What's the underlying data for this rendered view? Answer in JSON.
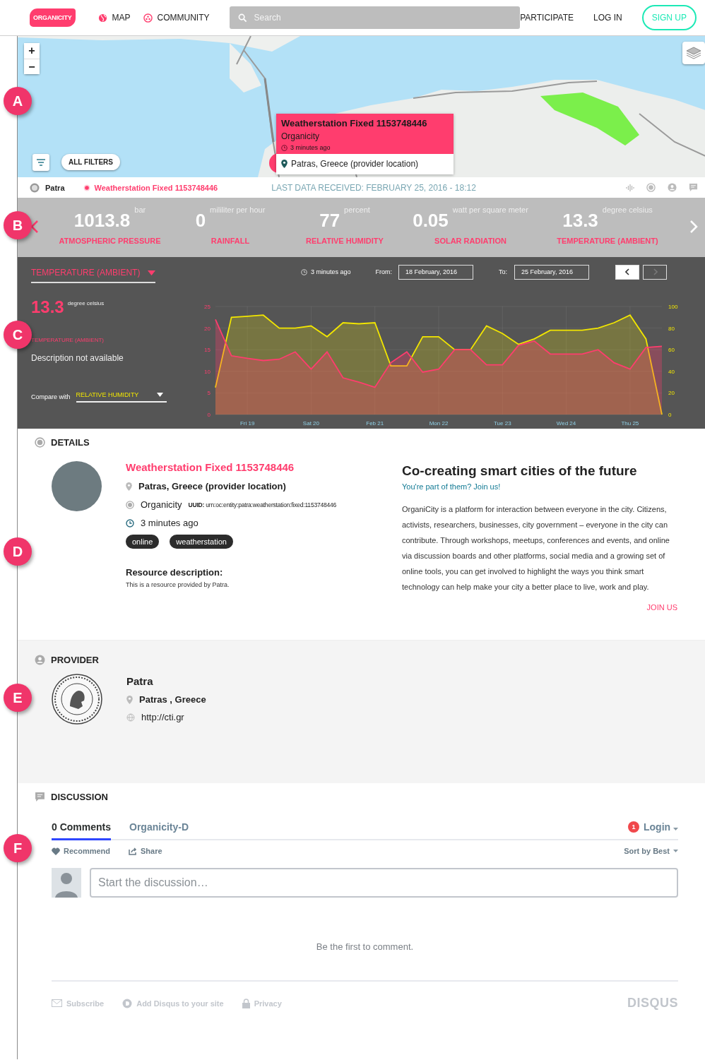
{
  "nav": {
    "logo": "ORGANICITY",
    "links": [
      {
        "label": "MAP",
        "kind": "globe"
      },
      {
        "label": "COMMUNITY",
        "kind": "community"
      }
    ],
    "search": {
      "placeholder": "Search"
    },
    "actions": [
      {
        "label": "PARTICIPATE",
        "kind": "link"
      },
      {
        "label": "LOG IN",
        "kind": "link"
      },
      {
        "label": "SIGN UP",
        "kind": "outline"
      }
    ]
  },
  "map": {
    "zoom_in": "+",
    "zoom_out": "−",
    "filters_button": "ALL FILTERS",
    "popup": {
      "title": "Weatherstation Fixed 1153748446",
      "provider": "Organicity",
      "time": "3 minutes ago",
      "location": "Patras, Greece (provider location)"
    }
  },
  "info_bar": {
    "provider": "Patra",
    "asset": "Weatherstation Fixed 1153748446",
    "last_data": "LAST DATA RECEIVED: FEBRUARY 25, 2016 - 18:12"
  },
  "metrics": [
    {
      "value": "1013.8",
      "unit": "bar",
      "label": "ATMOSPHERIC PRESSURE"
    },
    {
      "value": "0",
      "unit": "mililiter per hour",
      "label": "RAINFALL"
    },
    {
      "value": "77",
      "unit": "percent",
      "label": "RELATIVE HUMIDITY"
    },
    {
      "value": "0.05",
      "unit": "watt per square meter",
      "label": "SOLAR RADIATION"
    },
    {
      "value": "13.3",
      "unit": "degree celsius",
      "label": "TEMPERATURE (AMBIENT)"
    }
  ],
  "chart_panel": {
    "time": "3 minutes ago",
    "from_label": "From:",
    "from": "18 February, 2016",
    "to_label": "To:",
    "to": "25 February, 2016",
    "prev": {
      "disabled": false
    },
    "next": {
      "disabled": true
    },
    "current_value": "13.3",
    "current_unit": "degree celsius",
    "current_label": "TEMPERATURE (AMBIENT)",
    "description": "Description not available",
    "compare_label": "Compare with",
    "chart_data": {
      "type": "area",
      "grid": true,
      "ylim": [
        0,
        25
      ],
      "y2lim": [
        0,
        100
      ],
      "categories": [
        null,
        null,
        "Fri 19",
        null,
        null,
        null,
        "Sat 20",
        null,
        null,
        null,
        "Feb 21",
        null,
        null,
        null,
        "Mon 22",
        null,
        null,
        null,
        "Tue 23",
        null,
        null,
        null,
        "Wed 24",
        null,
        null,
        null,
        "Thu 25",
        null,
        null
      ],
      "yticks": [
        0,
        5,
        10,
        15,
        20,
        25
      ],
      "y2ticks": [
        0,
        20,
        40,
        60,
        80,
        100
      ],
      "series": [
        {
          "name": "RELATIVE HUMIDITY",
          "color": "#f2e600",
          "axis": "y2",
          "values": [
            25,
            90,
            91,
            92,
            80,
            80,
            82,
            72,
            85,
            84,
            85,
            45,
            45,
            72,
            72,
            60,
            60,
            82,
            75,
            65,
            70,
            78,
            78,
            78,
            80,
            85,
            92,
            70,
            0
          ]
        },
        {
          "name": "TEMPERATURE (AMBIENT)",
          "color": "#ff3d6e",
          "values": [
            22,
            13.6,
            13,
            12.5,
            12.8,
            14.5,
            10.5,
            14.5,
            8.5,
            7.5,
            6.3,
            12,
            14.5,
            9.8,
            10.5,
            15,
            15,
            11.5,
            11.5,
            16,
            17,
            14,
            14,
            14,
            15,
            12,
            10.5,
            15.5,
            15.8
          ]
        }
      ]
    }
  },
  "details": {
    "heading": "DETAILS",
    "title": "Weatherstation Fixed 1153748446",
    "location": "Patras, Greece (provider location)",
    "provider": "Organicity",
    "uuid_label": "UUID:",
    "uuid": "urn:oc:entity:patra:weatherstation:fixed:1153748446",
    "time": "3 minutes ago",
    "tags": [
      "online",
      "weatherstation"
    ],
    "description_label": "Resource description:",
    "description": "This is a resource provided by Patra.",
    "promo": {
      "title": "Co-creating smart cities of the future",
      "subtitle": "You're part of them? Join us!",
      "text": "OrganiCity is a platform for interaction between everyone in the city. Citizens, activists, researchers, businesses, city government – everyone in the city can contribute. Through workshops, meetups, conferences and events, and online via discussion boards and other platforms, social media and a growing set of online tools, you can get involved to highlight the ways you think smart technology can help make your city a better place to live, work and play.",
      "link": "JOIN US"
    }
  },
  "provider": {
    "heading": "PROVIDER",
    "name": "Patra",
    "location": "Patras , Greece",
    "url": "http://cti.gr"
  },
  "discussion": {
    "heading": "DISCUSSION",
    "tabs": [
      {
        "label": "0 Comments",
        "selected": true
      },
      {
        "label": "Organicity-D",
        "selected": false
      }
    ],
    "notifications": "1",
    "login": "Login",
    "recommend": "Recommend",
    "share": "Share",
    "sort": "Sort by Best",
    "placeholder": "Start the discussion…",
    "empty": "Be the first to comment.",
    "footer": [
      {
        "label": "Subscribe",
        "kind": "mail"
      },
      {
        "label": "Add Disqus to your site",
        "kind": "disqus"
      },
      {
        "label": "Privacy",
        "kind": "lock"
      }
    ],
    "brand": "DISQUS"
  },
  "callouts": [
    "A",
    "B",
    "C",
    "D",
    "E",
    "F"
  ]
}
